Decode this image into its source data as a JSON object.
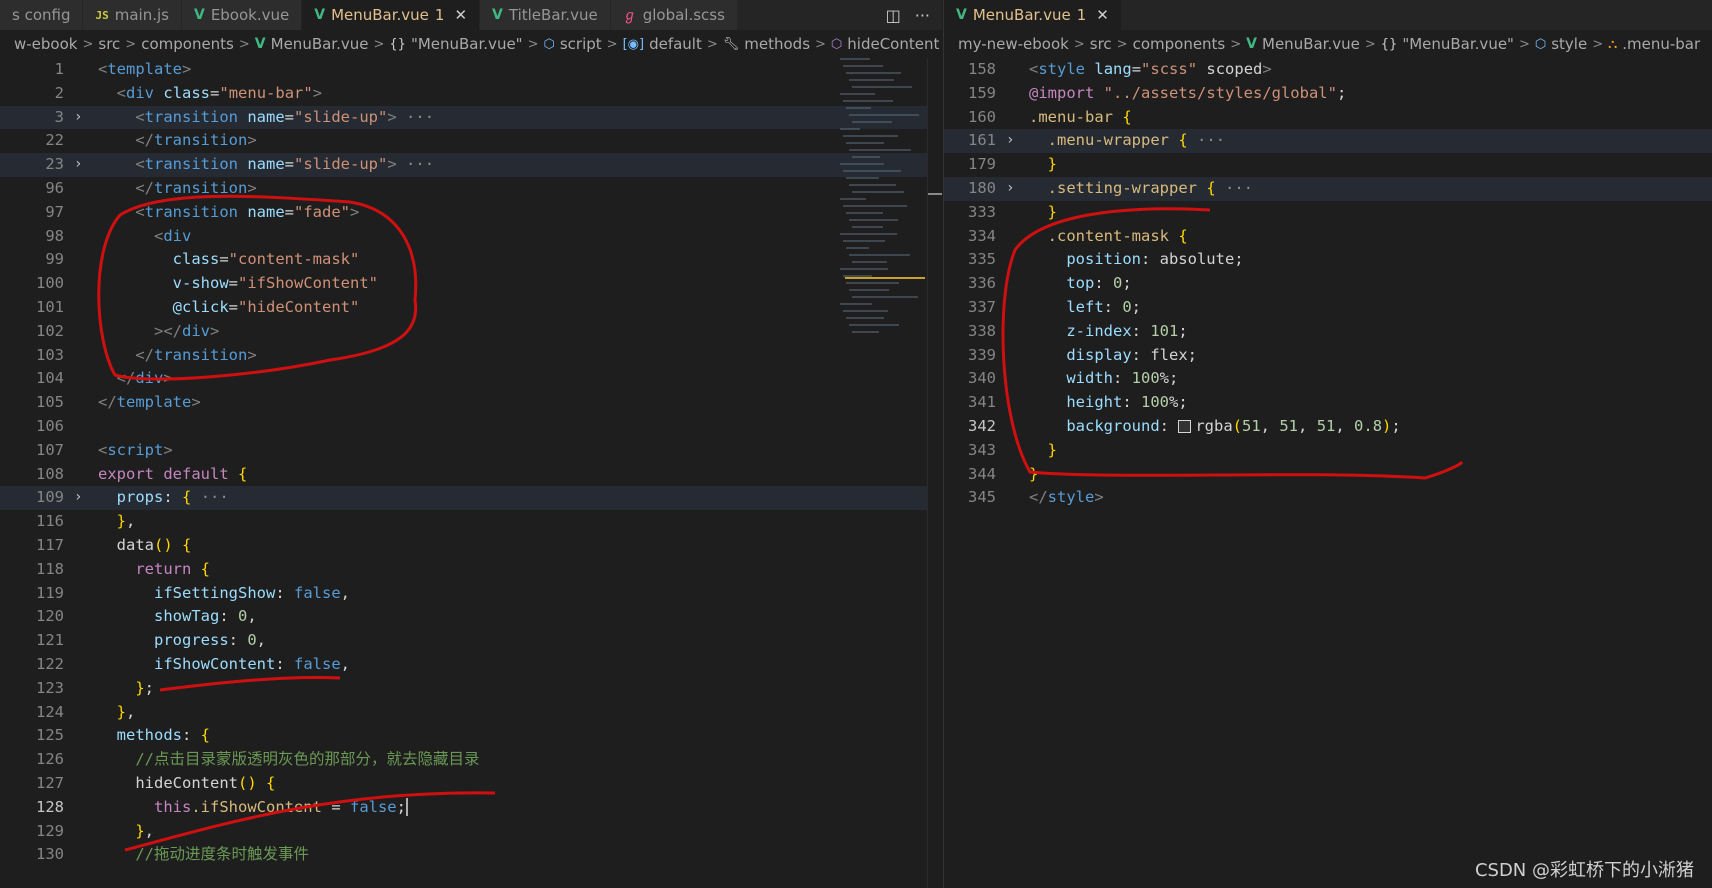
{
  "left": {
    "tabs": [
      {
        "label": "s config",
        "icon": "none",
        "active": false
      },
      {
        "label": "main.js",
        "icon": "js-icon",
        "active": false
      },
      {
        "label": "Ebook.vue",
        "icon": "vue-icon",
        "active": false
      },
      {
        "label": "MenuBar.vue",
        "badge": "1",
        "icon": "vue-icon",
        "active": true
      },
      {
        "label": "TitleBar.vue",
        "icon": "vue-icon",
        "active": false
      },
      {
        "label": "global.scss",
        "icon": "scss-icon",
        "active": false
      }
    ],
    "breadcrumb": [
      "w-ebook",
      "src",
      "components",
      "MenuBar.vue",
      "\"MenuBar.vue\"",
      "script",
      "default",
      "methods",
      "hideContent"
    ],
    "lines": [
      {
        "n": "1",
        "code": "<template>"
      },
      {
        "n": "2",
        "code": "  <div class=\"menu-bar\">"
      },
      {
        "n": "3",
        "code": "    <transition name=\"slide-up\"> ···",
        "fold": true,
        "hl": true
      },
      {
        "n": "22",
        "code": "    </transition>"
      },
      {
        "n": "23",
        "code": "    <transition name=\"slide-up\"> ···",
        "fold": true,
        "hl": true
      },
      {
        "n": "96",
        "code": "    </transition>"
      },
      {
        "n": "97",
        "code": "    <transition name=\"fade\">"
      },
      {
        "n": "98",
        "code": "      <div"
      },
      {
        "n": "99",
        "code": "        class=\"content-mask\""
      },
      {
        "n": "100",
        "code": "        v-show=\"ifShowContent\""
      },
      {
        "n": "101",
        "code": "        @click=\"hideContent\""
      },
      {
        "n": "102",
        "code": "      ></div>"
      },
      {
        "n": "103",
        "code": "    </transition>"
      },
      {
        "n": "104",
        "code": "  </div>"
      },
      {
        "n": "105",
        "code": "</template>"
      },
      {
        "n": "106",
        "code": ""
      },
      {
        "n": "107",
        "code": "<script>"
      },
      {
        "n": "108",
        "code": "export default {"
      },
      {
        "n": "109",
        "code": "  props: { ···",
        "fold": true,
        "hl": true
      },
      {
        "n": "116",
        "code": "  },"
      },
      {
        "n": "117",
        "code": "  data() {"
      },
      {
        "n": "118",
        "code": "    return {"
      },
      {
        "n": "119",
        "code": "      ifSettingShow: false,"
      },
      {
        "n": "120",
        "code": "      showTag: 0,"
      },
      {
        "n": "121",
        "code": "      progress: 0,"
      },
      {
        "n": "122",
        "code": "      ifShowContent: false,"
      },
      {
        "n": "123",
        "code": "    };"
      },
      {
        "n": "124",
        "code": "  },"
      },
      {
        "n": "125",
        "code": "  methods: {"
      },
      {
        "n": "126",
        "code": "    //点击目录蒙版透明灰色的那部分，就去隐藏目录"
      },
      {
        "n": "127",
        "code": "    hideContent() {"
      },
      {
        "n": "128",
        "code": "      this.ifShowContent = false;",
        "current": true
      },
      {
        "n": "129",
        "code": "    },"
      },
      {
        "n": "130",
        "code": "    //拖动进度条时触发事件"
      }
    ]
  },
  "right": {
    "tabs": [
      {
        "label": "MenuBar.vue",
        "badge": "1",
        "icon": "vue-icon",
        "active": true
      }
    ],
    "breadcrumb": [
      "my-new-ebook",
      "src",
      "components",
      "MenuBar.vue",
      "\"MenuBar.vue\"",
      "style",
      ".menu-bar"
    ],
    "lines": [
      {
        "n": "158",
        "code": "<style lang=\"scss\" scoped>"
      },
      {
        "n": "159",
        "code": "@import \"../assets/styles/global\";"
      },
      {
        "n": "160",
        "code": ".menu-bar {"
      },
      {
        "n": "161",
        "code": "  .menu-wrapper { ···",
        "fold": true,
        "hl": true
      },
      {
        "n": "179",
        "code": "  }"
      },
      {
        "n": "180",
        "code": "  .setting-wrapper { ···",
        "fold": true,
        "hl": true
      },
      {
        "n": "333",
        "code": "  }"
      },
      {
        "n": "334",
        "code": "  .content-mask {"
      },
      {
        "n": "335",
        "code": "    position: absolute;"
      },
      {
        "n": "336",
        "code": "    top: 0;"
      },
      {
        "n": "337",
        "code": "    left: 0;"
      },
      {
        "n": "338",
        "code": "    z-index: 101;"
      },
      {
        "n": "339",
        "code": "    display: flex;"
      },
      {
        "n": "340",
        "code": "    width: 100%;"
      },
      {
        "n": "341",
        "code": "    height: 100%;"
      },
      {
        "n": "342",
        "code": "    background: rgba(51, 51, 51, 0.8);",
        "current": true
      },
      {
        "n": "343",
        "code": "  }"
      },
      {
        "n": "344",
        "code": "}"
      },
      {
        "n": "345",
        "code": "</style>"
      }
    ]
  },
  "watermark": "CSDN @彩虹桥下的小淅猪",
  "colors": {
    "annotation": "#d01010",
    "vue": "#41b883",
    "active_tab_text": "#e2c08d"
  }
}
